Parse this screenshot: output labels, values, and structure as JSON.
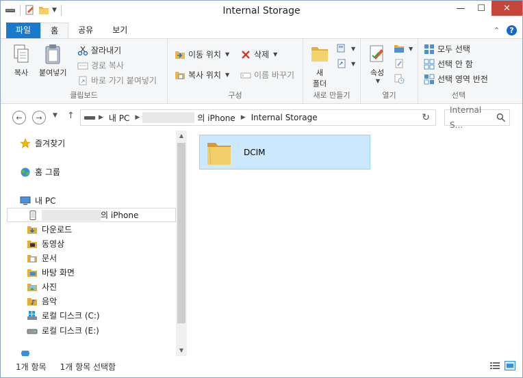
{
  "window": {
    "title": "Internal Storage"
  },
  "tabs": [
    {
      "label": "파일"
    },
    {
      "label": "홈"
    },
    {
      "label": "공유"
    },
    {
      "label": "보기"
    }
  ],
  "help": {
    "label": "?"
  },
  "ribbon": {
    "clipboard": {
      "label": "클립보드",
      "copy": "복사",
      "paste": "붙여넣기",
      "cut": "잘라내기",
      "copy_path": "경로 복사",
      "paste_shortcut": "바로 가기 붙여넣기"
    },
    "organize": {
      "label": "구성",
      "move_to": "이동 위치",
      "copy_to": "복사 위치",
      "delete": "삭제",
      "rename": "이름 바꾸기"
    },
    "new": {
      "label": "새로 만들기",
      "new_folder_line1": "새",
      "new_folder_line2": "폴더"
    },
    "open": {
      "label": "열기",
      "properties": "속성"
    },
    "select": {
      "label": "선택",
      "select_all": "모두 선택",
      "select_none": "선택 안 함",
      "invert": "선택 영역 반전"
    }
  },
  "address": {
    "segments": [
      "내 PC",
      "의 iPhone",
      "Internal Storage"
    ],
    "search_placeholder": "Internal S..."
  },
  "nav": {
    "favorites": "즐겨찾기",
    "homegroup": "홈 그룹",
    "this_pc": "내 PC",
    "iphone": "의 iPhone",
    "downloads": "다운로드",
    "videos": "동영상",
    "documents": "문서",
    "desktop": "바탕 화면",
    "pictures": "사진",
    "music": "음악",
    "drive_c": "로컬 디스크 (C:)",
    "drive_e": "로컬 디스크 (E:)"
  },
  "content": {
    "items": [
      {
        "name": "DCIM"
      }
    ]
  },
  "status": {
    "count": "1개 항목",
    "selected": "1개 항목 선택함"
  },
  "colors": {
    "file_tab": "#1979ca",
    "selection": "#cce8ff",
    "close": "#c7463a"
  }
}
